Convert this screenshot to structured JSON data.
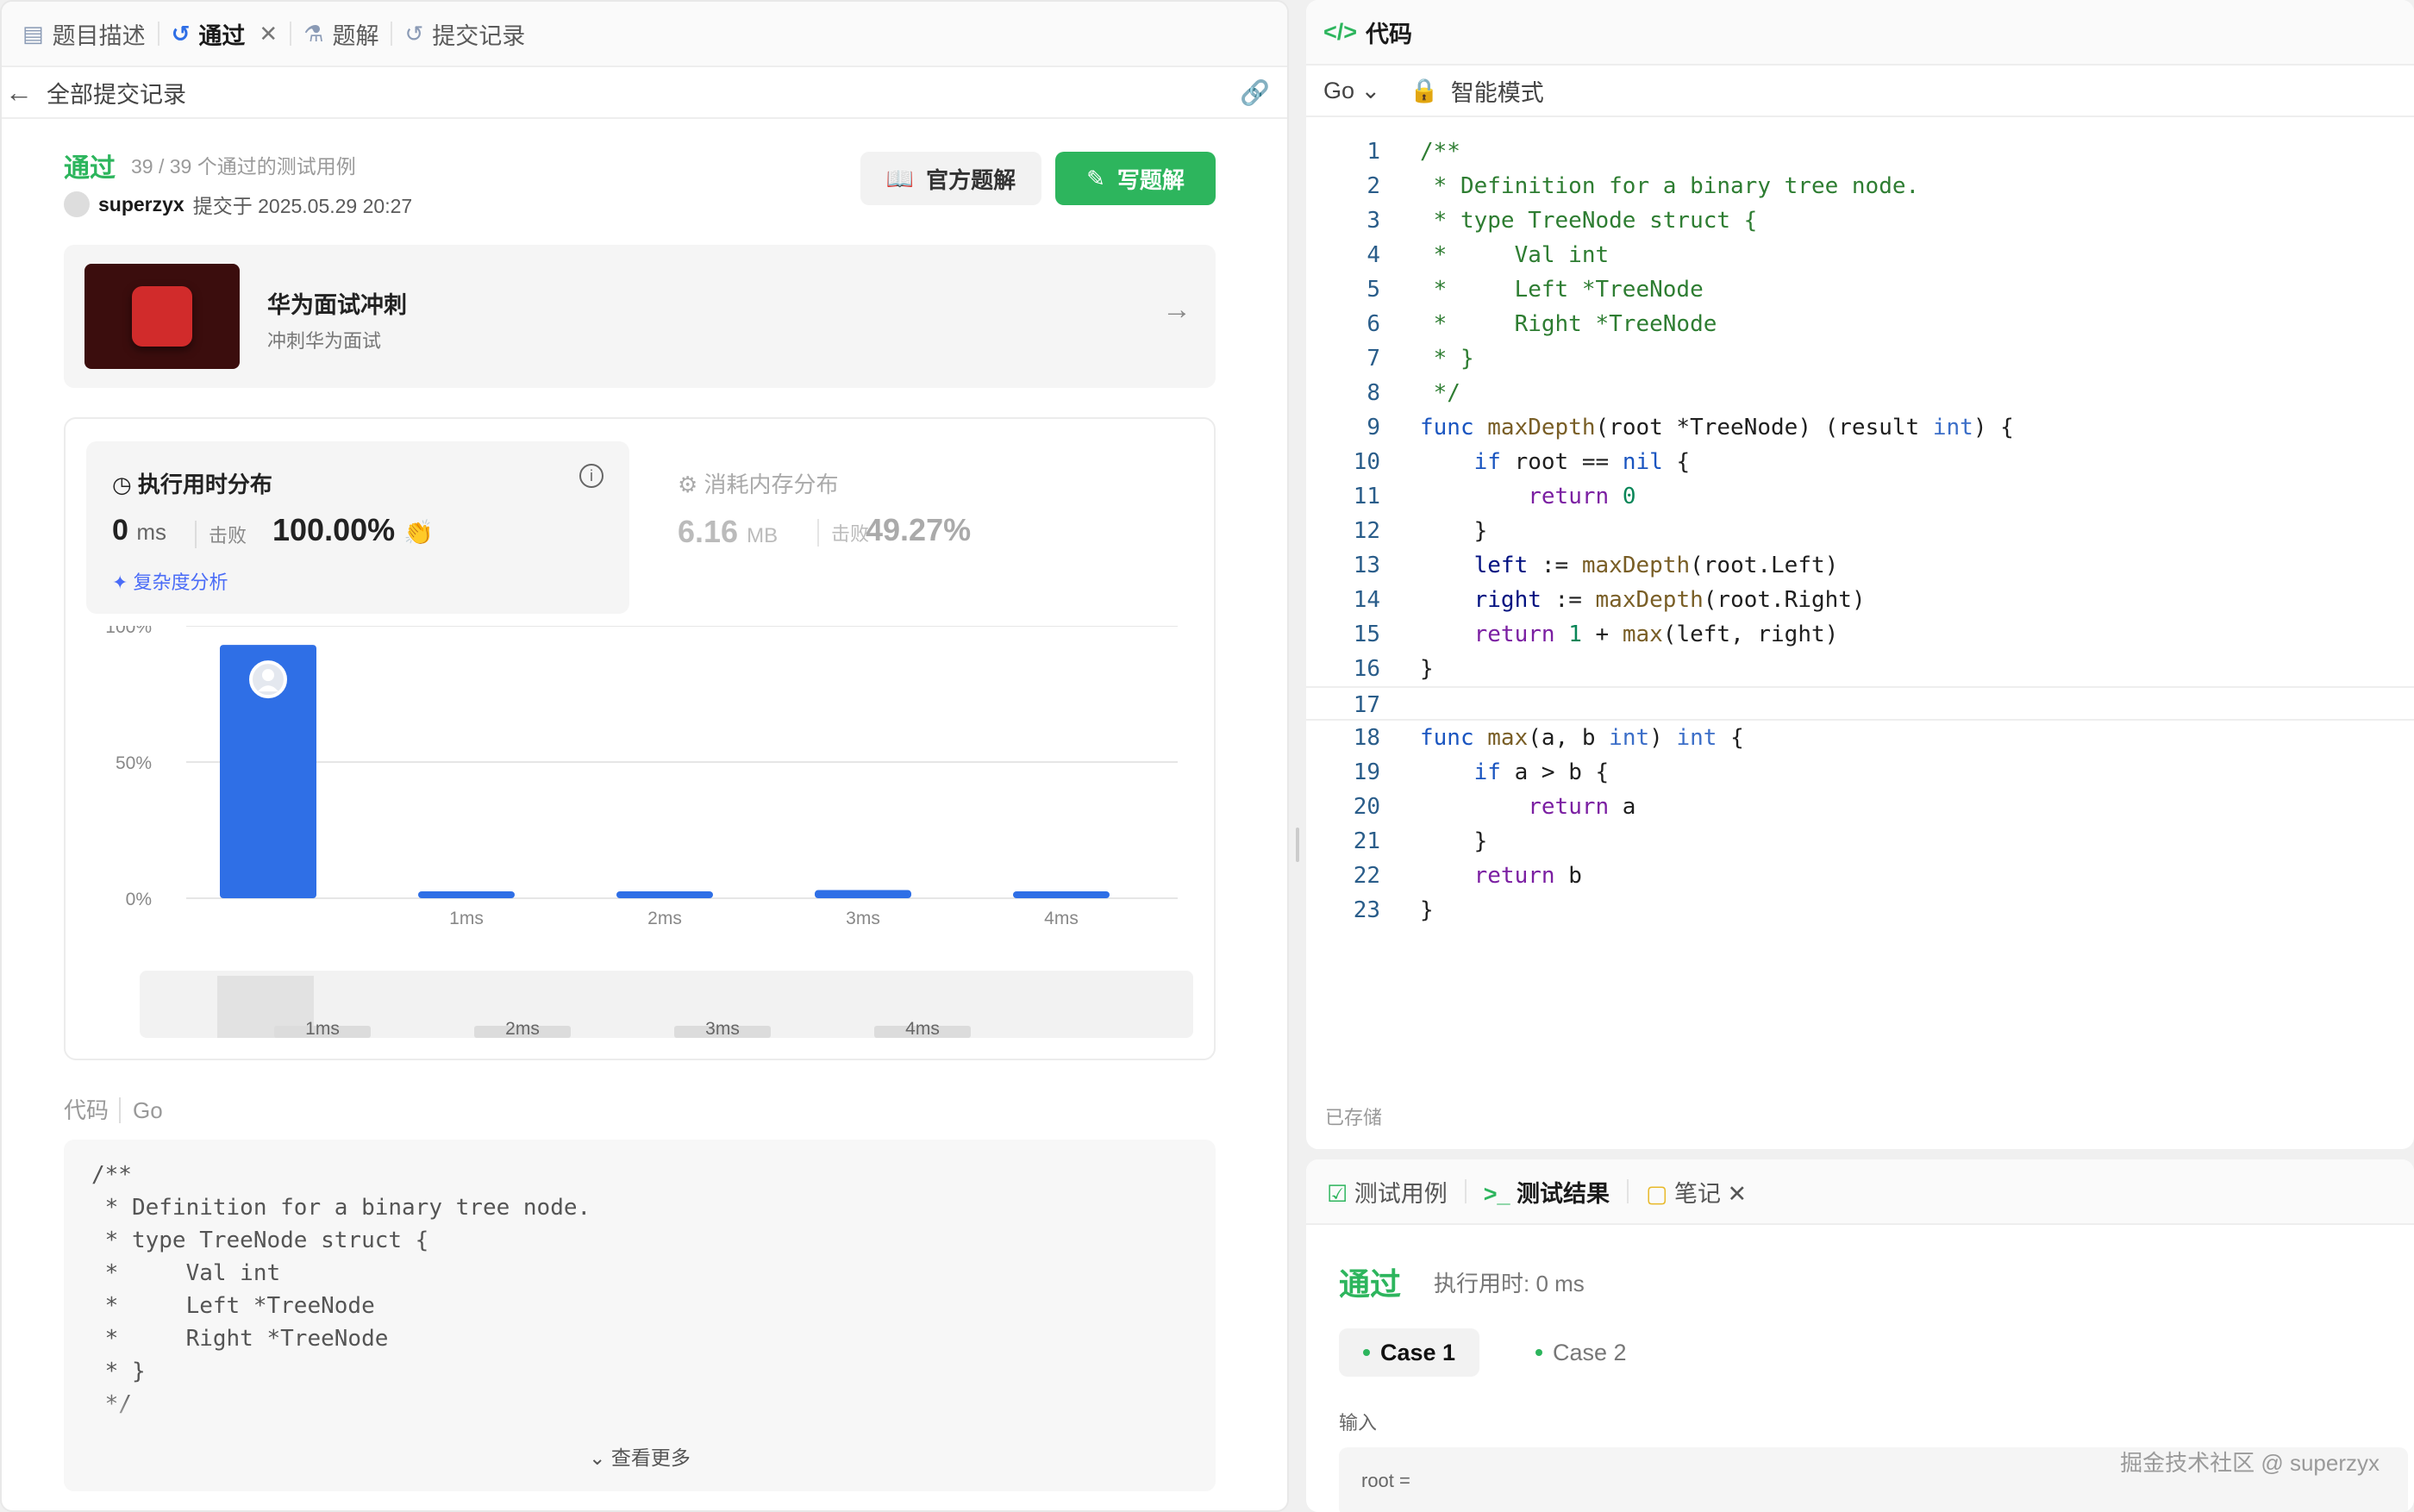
{
  "left_tabs": [
    {
      "label": "题目描述",
      "icon": "doc-icon"
    },
    {
      "label": "通过",
      "icon": "history-icon",
      "closable": true,
      "active": true
    },
    {
      "label": "题解",
      "icon": "flask-icon"
    },
    {
      "label": "提交记录",
      "icon": "history-icon"
    }
  ],
  "back": {
    "label": "全部提交记录"
  },
  "submission": {
    "status": "通过",
    "tests": "39 / 39 个通过的测试用例",
    "user": "superzyx",
    "submitted": "提交于 2025.05.29 20:27",
    "btn_official": "官方题解",
    "btn_write": "写题解"
  },
  "promo": {
    "title": "华为面试冲刺",
    "subtitle": "冲刺华为面试"
  },
  "runtime": {
    "title": "执行用时分布",
    "value": "0",
    "unit": "ms",
    "beat_label": "击败",
    "beat": "100.00%",
    "complexity": "复杂度分析"
  },
  "memory": {
    "title": "消耗内存分布",
    "value": "6.16",
    "unit": "MB",
    "beat_label": "击败",
    "beat": "49.27%"
  },
  "chart_data": {
    "type": "bar",
    "categories": [
      "",
      "1ms",
      "2ms",
      "3ms",
      "4ms"
    ],
    "values": [
      93,
      2,
      2,
      3,
      2
    ],
    "yticks": [
      "100%",
      "50%",
      "0%"
    ],
    "ylim": [
      0,
      100
    ],
    "highlight_index": 0,
    "color": "#2f6fe6"
  },
  "slider_labels": [
    "1ms",
    "2ms",
    "3ms",
    "4ms"
  ],
  "code_section": {
    "label": "代码",
    "lang": "Go",
    "preview": "/**\n * Definition for a binary tree node.\n * type TreeNode struct {\n *     Val int\n *     Left *TreeNode\n *     Right *TreeNode\n * }\n */",
    "more": "查看更多"
  },
  "editor": {
    "title": "代码",
    "lang": "Go",
    "mode": "智能模式",
    "saved": "已存储"
  },
  "bottom_tabs": [
    {
      "label": "测试用例",
      "icon": "checkbox-icon"
    },
    {
      "label": "测试结果",
      "icon": "terminal-icon",
      "active": true
    },
    {
      "label": "笔记",
      "icon": "note-icon",
      "closable": true
    }
  ],
  "result": {
    "status": "通过",
    "time": "执行用时: 0 ms",
    "cases": [
      "Case 1",
      "Case 2"
    ],
    "input_label": "输入",
    "input_prefix": "root ="
  },
  "watermark": "掘金技术社区 @ superzyx",
  "colors": {
    "accent_green": "#2db55d",
    "accent_blue": "#2f6fe6"
  }
}
